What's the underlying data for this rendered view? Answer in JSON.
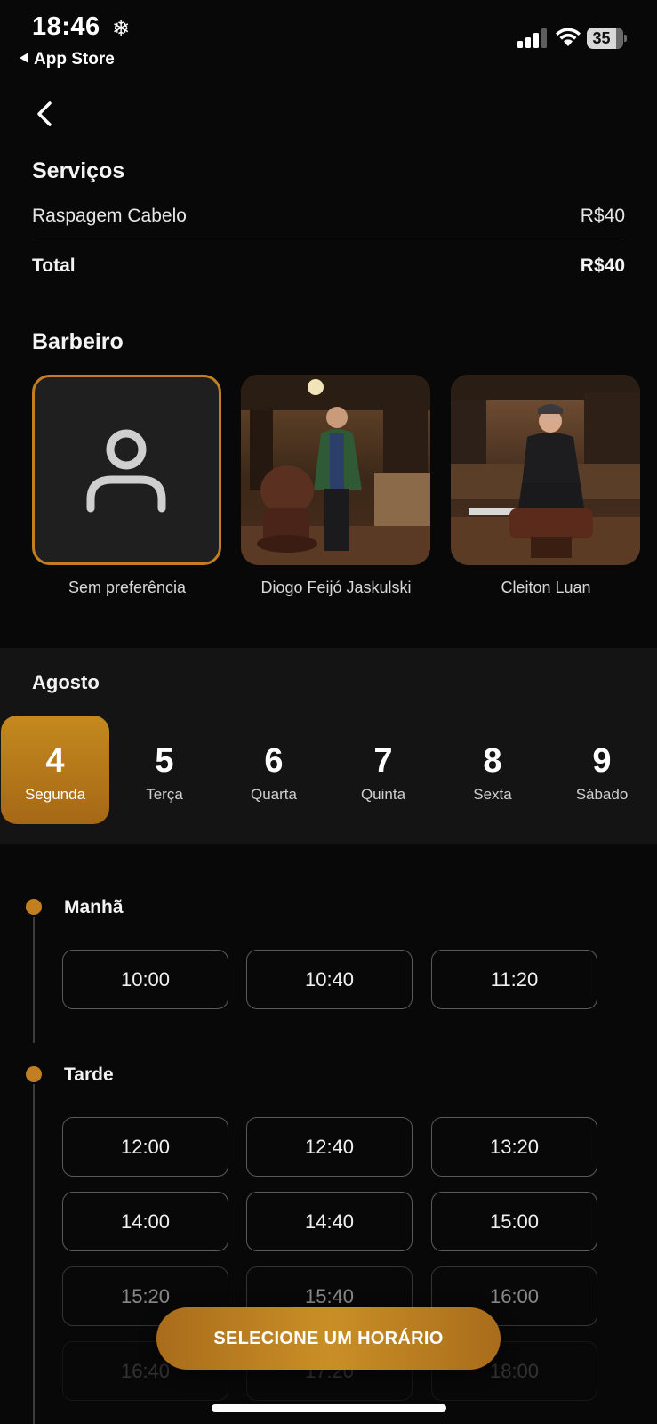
{
  "status_bar": {
    "time": "18:46",
    "back_app": "App Store",
    "battery": "35"
  },
  "services": {
    "title": "Serviços",
    "items": [
      {
        "name": "Raspagem Cabelo",
        "price": "R$40"
      }
    ],
    "total_label": "Total",
    "total_value": "R$40"
  },
  "barber": {
    "title": "Barbeiro",
    "options": [
      {
        "name": "Sem preferência",
        "selected": true
      },
      {
        "name": "Diogo Feijó Jaskulski",
        "selected": false
      },
      {
        "name": "Cleiton Luan",
        "selected": false
      }
    ]
  },
  "calendar": {
    "month": "Agosto",
    "days": [
      {
        "number": "4",
        "weekday": "Segunda",
        "selected": true
      },
      {
        "number": "5",
        "weekday": "Terça",
        "selected": false
      },
      {
        "number": "6",
        "weekday": "Quarta",
        "selected": false
      },
      {
        "number": "7",
        "weekday": "Quinta",
        "selected": false
      },
      {
        "number": "8",
        "weekday": "Sexta",
        "selected": false
      },
      {
        "number": "9",
        "weekday": "Sábado",
        "selected": false
      }
    ]
  },
  "schedule": {
    "morning_label": "Manhã",
    "morning_slots": [
      "10:00",
      "10:40",
      "11:20"
    ],
    "afternoon_label": "Tarde",
    "afternoon_slots": [
      "12:00",
      "12:40",
      "13:20",
      "14:00",
      "14:40",
      "15:00",
      "15:20",
      "15:40",
      "16:00",
      "16:40",
      "17:20",
      "18:00"
    ]
  },
  "cta_label": "SELECIONE UM HORÁRIO",
  "colors": {
    "accent": "#c17f21",
    "background": "#080808",
    "band": "#141414"
  }
}
